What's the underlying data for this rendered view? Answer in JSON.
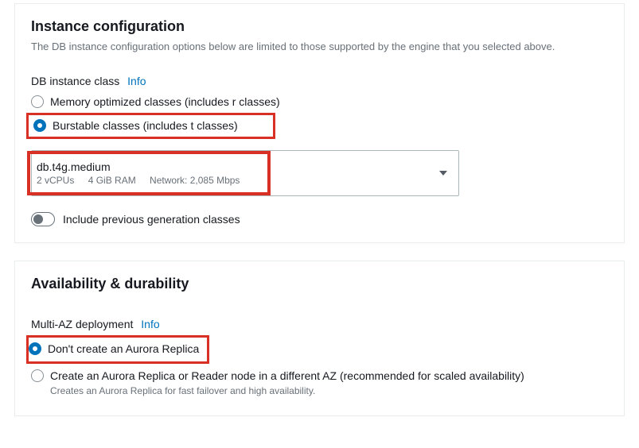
{
  "instance_config": {
    "title": "Instance configuration",
    "description": "The DB instance configuration options below are limited to those supported by the engine that you selected above.",
    "db_class_label": "DB instance class",
    "info_link": "Info",
    "options": {
      "memory": "Memory optimized classes (includes r classes)",
      "burstable": "Burstable classes (includes t classes)"
    },
    "selected_instance": {
      "name": "db.t4g.medium",
      "vcpus": "2 vCPUs",
      "ram": "4 GiB RAM",
      "network": "Network: 2,085 Mbps"
    },
    "toggle_prev_gen": "Include previous generation classes"
  },
  "availability": {
    "title": "Availability & durability",
    "multi_az_label": "Multi-AZ deployment",
    "info_link": "Info",
    "options": {
      "no_replica": "Don't create an Aurora Replica",
      "create_replica": "Create an Aurora Replica or Reader node in a different AZ (recommended for scaled availability)",
      "create_replica_hint": "Creates an Aurora Replica for fast failover and high availability."
    }
  }
}
